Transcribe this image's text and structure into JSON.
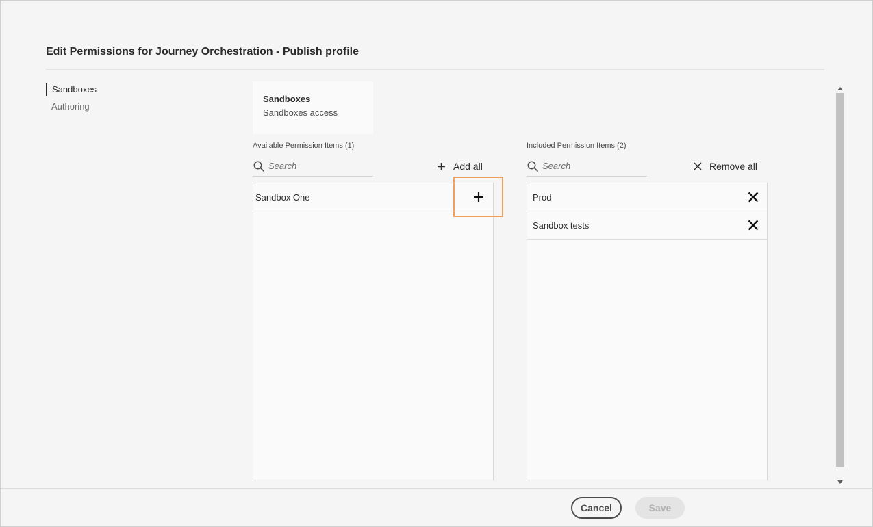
{
  "dialog": {
    "title": "Edit Permissions for Journey Orchestration - Publish profile"
  },
  "side_nav": {
    "items": [
      {
        "label": "Sandboxes",
        "active": true
      },
      {
        "label": "Authoring",
        "active": false
      }
    ]
  },
  "category_card": {
    "title": "Sandboxes",
    "subtitle": "Sandboxes access"
  },
  "available": {
    "label": "Available Permission Items (1)",
    "search_placeholder": "Search",
    "action_label": "Add all",
    "items": [
      "Sandbox One"
    ]
  },
  "included": {
    "label": "Included Permission Items (2)",
    "search_placeholder": "Search",
    "action_label": "Remove all",
    "items": [
      "Prod",
      "Sandbox tests"
    ]
  },
  "footer": {
    "cancel_label": "Cancel",
    "save_label": "Save"
  },
  "icons": {
    "search": "search-icon",
    "add": "plus-icon",
    "remove": "close-icon"
  },
  "colors": {
    "highlight": "#f0a058",
    "background": "#f5f5f5",
    "panel": "#fafafa"
  }
}
